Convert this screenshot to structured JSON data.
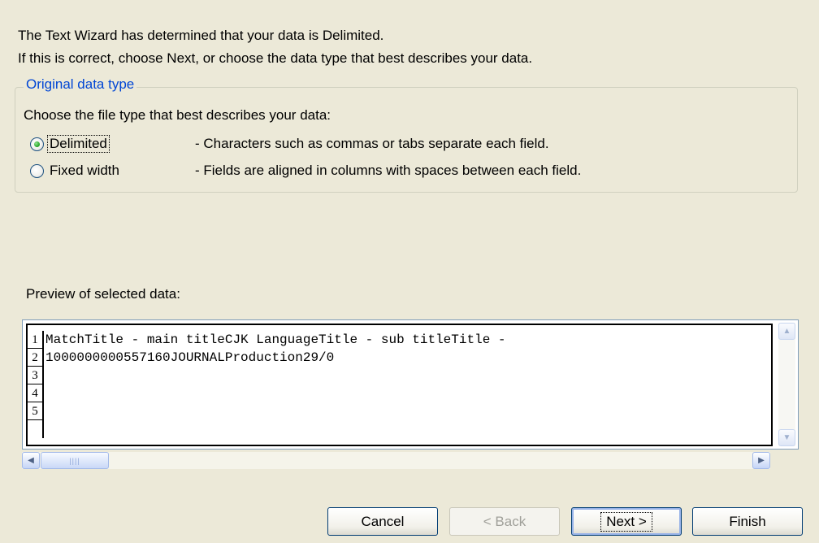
{
  "intro": {
    "line1": "The Text Wizard has determined that your data is Delimited.",
    "line2": "If this is correct, choose Next, or choose the data type that best describes your data."
  },
  "original_data_type": {
    "legend": "Original data type",
    "prompt": "Choose the file type that best describes your data:",
    "options": [
      {
        "label": "Delimited",
        "description": "- Characters such as commas or tabs separate each field.",
        "selected": true
      },
      {
        "label": "Fixed width",
        "description": "- Fields are aligned in columns with spaces between each field.",
        "selected": false
      }
    ]
  },
  "preview": {
    "label": "Preview of selected data:",
    "rows": [
      {
        "num": "1",
        "text": "MatchTitle - main titleCJK LanguageTitle - sub titleTitle -"
      },
      {
        "num": "2",
        "text": "1000000000557160JOURNALProduction29/0"
      },
      {
        "num": "3",
        "text": ""
      },
      {
        "num": "4",
        "text": ""
      },
      {
        "num": "5",
        "text": ""
      }
    ]
  },
  "buttons": {
    "cancel": "Cancel",
    "back": "< Back",
    "next": "Next >",
    "finish": "Finish"
  },
  "icons": {
    "scroll_up": "chevron-up-icon",
    "scroll_down": "chevron-down-icon",
    "scroll_left": "chevron-left-icon",
    "scroll_right": "chevron-right-icon"
  }
}
